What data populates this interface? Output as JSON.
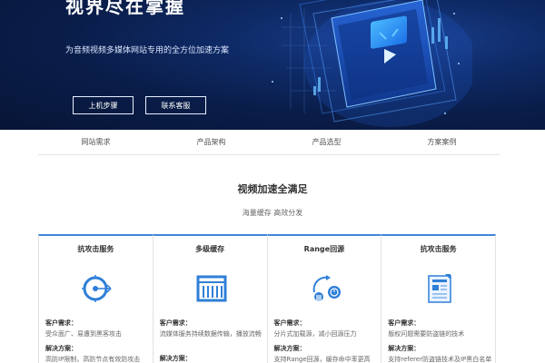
{
  "hero": {
    "title": "视界尽在掌握",
    "subtitle": "为音频视频多媒体网站专用的全方位加速方案",
    "buttons": [
      "上机步骤",
      "联系客服"
    ]
  },
  "nav": {
    "items": [
      "网站需求",
      "产品架构",
      "产品选型",
      "方案案例"
    ]
  },
  "section": {
    "title": "视频加速全满足",
    "subtitle": "海量缓存 高效分发"
  },
  "cards": [
    {
      "title": "抗攻击服务",
      "icon": "target-icon",
      "req_label": "客户需求：",
      "req_text": "受众面广、易遭到黑客攻击",
      "sol_label": "解决方案：",
      "sol_text": "高防IP限制，高防节点有效防攻击"
    },
    {
      "title": "多级缓存",
      "icon": "storage-icon",
      "req_label": "客户需求：",
      "req_text": "流媒体服务持续数据传输，播放流畅",
      "sol_label": "解决方案：",
      "sol_text": ""
    },
    {
      "title": "Range回源",
      "icon": "range-icon",
      "req_label": "客户需求：",
      "req_text": "分片式加载源，减小回源压力",
      "sol_label": "解决方案：",
      "sol_text": "支持Range回源，缓存命中率更高"
    },
    {
      "title": "抗攻击服务",
      "icon": "document-icon",
      "req_label": "客户需求：",
      "req_text": "版权问题需要防盗链的技术",
      "sol_label": "解决方案：",
      "sol_text": "支持referer防盗链技术及IP黑白名单"
    }
  ],
  "colors": {
    "hero_bg": "#0a1d49",
    "accent": "#3f86d9"
  }
}
